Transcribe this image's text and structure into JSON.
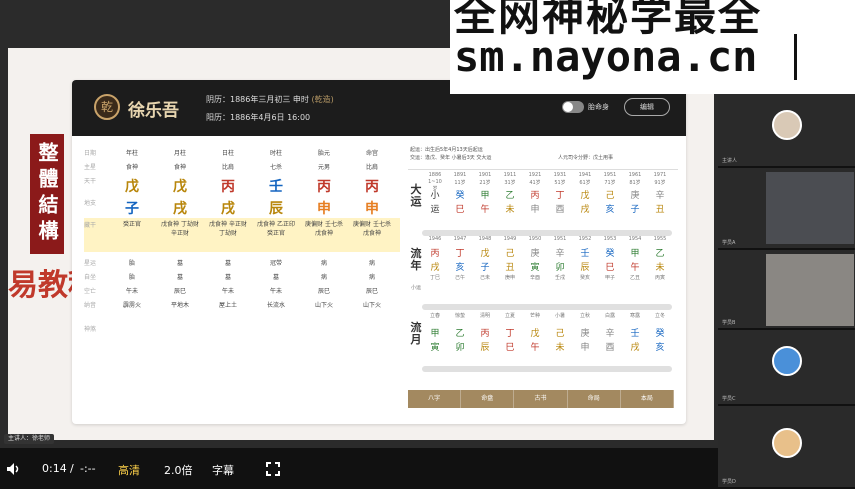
{
  "watermark": {
    "line1": "全网神秘学最全",
    "line2": "sm.nayona.cn"
  },
  "banner": {
    "vertical_text": "整體結構",
    "course_title": "易教程"
  },
  "app": {
    "name": "徐乐吾",
    "logo_glyph": "乾",
    "lunar_label": "阴历：1886年三月初三 申时",
    "lunar_tag": "(乾造)",
    "solar_label": "阳历：1886年4月6日 16:00",
    "toggle_label": "胎命身",
    "edit_label": "编辑"
  },
  "pillars": {
    "row_labels": [
      "日期",
      "主星",
      "天干",
      "地支",
      "藏干",
      "副星",
      "星运",
      "自坐",
      "空亡",
      "纳音",
      "神煞"
    ],
    "headers": [
      "年柱",
      "月柱",
      "日柱",
      "时柱",
      "胎元",
      "命宫"
    ],
    "main_stars": [
      "食神",
      "食神",
      "比肩",
      "七杀",
      "元男",
      "比肩"
    ],
    "stems": [
      "戊",
      "戊",
      "丙",
      "壬",
      "丙",
      "丙"
    ],
    "branches": [
      "子",
      "戌",
      "戌",
      "辰",
      "申",
      "申"
    ],
    "hidden": [
      "癸正官",
      "戊食神 丁劫财 辛正财",
      "戊食神 辛正财 丁劫财",
      "戊食神 乙正印 癸正官",
      "庚偏财 壬七杀 戊食神",
      "庚偏财 壬七杀 戊食神"
    ],
    "star_fortune": [
      "胎",
      "墓",
      "墓",
      "冠带",
      "病",
      "病"
    ],
    "self_seat": [
      "胎",
      "墓",
      "墓",
      "墓",
      "病",
      "病"
    ],
    "void": [
      "午未",
      "辰巳",
      "午未",
      "午未",
      "辰巳",
      "辰巳"
    ],
    "nayin": [
      "霹雳火",
      "平地木",
      "屋上土",
      "长流水",
      "山下火",
      "山下火"
    ]
  },
  "dayun": {
    "label": "大运",
    "head_left": "起运：出生后5年4月13天后起运",
    "head_left2": "交运：逢戊、癸年 小暑后3天 交大运",
    "head_right": "人元司令分野：戊土用事",
    "years": [
      "1886",
      "1891",
      "1901",
      "1911",
      "1921",
      "1931",
      "1941",
      "1951",
      "1961",
      "1971"
    ],
    "ages": [
      "1~10岁",
      "11岁",
      "21岁",
      "31岁",
      "41岁",
      "51岁",
      "61岁",
      "71岁",
      "81岁",
      "91岁"
    ],
    "stems": [
      "小",
      "癸",
      "甲",
      "乙",
      "丙",
      "丁",
      "戊",
      "己",
      "庚",
      "辛"
    ],
    "branches": [
      "运",
      "巳",
      "午",
      "未",
      "申",
      "酉",
      "戌",
      "亥",
      "子",
      "丑"
    ]
  },
  "liunian": {
    "label": "流年",
    "sub": "小运",
    "years": [
      "1946",
      "1947",
      "1948",
      "1949",
      "1950",
      "1951",
      "1952",
      "1953",
      "1954",
      "1955"
    ],
    "stems": [
      "丙",
      "丁",
      "戊",
      "己",
      "庚",
      "辛",
      "壬",
      "癸",
      "甲",
      "乙"
    ],
    "branches": [
      "戌",
      "亥",
      "子",
      "丑",
      "寅",
      "卯",
      "辰",
      "巳",
      "午",
      "未"
    ],
    "xiaoyun": [
      "丁巳",
      "己午",
      "己未",
      "庚申",
      "辛酉",
      "壬戌",
      "癸亥",
      "甲子",
      "乙丑",
      "丙寅"
    ]
  },
  "liuyue": {
    "label": "流月",
    "terms": [
      "立春",
      "惊蛰",
      "清明",
      "立夏",
      "芒种",
      "小暑",
      "立秋",
      "白露",
      "寒露",
      "立冬"
    ],
    "stems": [
      "甲",
      "乙",
      "丙",
      "丁",
      "戊",
      "己",
      "庚",
      "辛",
      "壬",
      "癸"
    ],
    "branches": [
      "寅",
      "卯",
      "辰",
      "巳",
      "午",
      "未",
      "申",
      "酉",
      "戌",
      "亥"
    ]
  },
  "bottom_tabs": [
    "八字",
    "命盘",
    "古书",
    "命局",
    "本局"
  ],
  "player": {
    "time_current": "0:14",
    "time_sep": "/",
    "time_total": "-:--",
    "quality": "高清",
    "speed": "2.0倍",
    "subtitles": "字幕"
  },
  "chip": "主讲人：徐老师",
  "participants": [
    {
      "name": "主讲人"
    },
    {
      "name": "学员A"
    },
    {
      "name": "学员B"
    },
    {
      "name": "学员C"
    },
    {
      "name": "学员D"
    }
  ],
  "colors": {
    "accent_red": "#c0392b",
    "wood_green": "#2e7d32",
    "water_blue": "#1565c0",
    "earth_gold": "#b8860b",
    "fire_orange": "#e67e22",
    "gold_bar": "#a38960"
  }
}
